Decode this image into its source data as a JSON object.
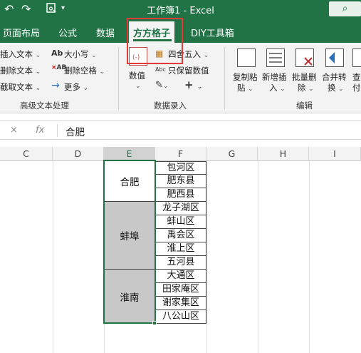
{
  "titlebar": {
    "title": "工作簿1  -  Excel",
    "undo_icon": "undo-icon",
    "redo_icon": "redo-icon",
    "search_icon": "search-icon"
  },
  "tabs": [
    {
      "label": "页面布局",
      "active": false
    },
    {
      "label": "公式",
      "active": false
    },
    {
      "label": "数据",
      "active": false
    },
    {
      "label": "方方格子",
      "active": true
    },
    {
      "label": "DIY工具箱",
      "active": false
    }
  ],
  "ribbon": {
    "group1": {
      "items_left": [
        "插入文本",
        "删除文本",
        "截取文本"
      ],
      "items_right": [
        "大小写",
        "删除空格",
        "更多"
      ],
      "glyphs": [
        "Ab",
        "AB",
        "→"
      ],
      "label": "高级文本处理"
    },
    "group2": {
      "value_button": "数值",
      "items": [
        "四舍五入",
        "只保留数值"
      ],
      "abc_glyph": "Abc",
      "label": "数据录入"
    },
    "group3": {
      "buttons": [
        {
          "line1": "复制粘",
          "line2": "贴"
        },
        {
          "line1": "新增插",
          "line2": "入"
        },
        {
          "line1": "批量删",
          "line2": "除"
        },
        {
          "line1": "合并转",
          "line2": "换"
        },
        {
          "line1": "查",
          "line2": "付"
        }
      ],
      "label": "编辑"
    }
  },
  "formula_bar": {
    "cancel": "×",
    "fx": "fx",
    "value": "合肥"
  },
  "columns": [
    "C",
    "D",
    "E",
    "F",
    "G",
    "H",
    "I"
  ],
  "selected_column": "E",
  "merged_cells": [
    {
      "label": "合肥",
      "rows": 3,
      "shaded": false
    },
    {
      "label": "蚌埠",
      "rows": 5,
      "shaded": true
    },
    {
      "label": "淮南",
      "rows": 4,
      "shaded": true
    }
  ],
  "districts": [
    "包河区",
    "肥东县",
    "肥西县",
    "龙子湖区",
    "蚌山区",
    "禹会区",
    "淮上区",
    "五河县",
    "大通区",
    "田家庵区",
    "谢家集区",
    "八公山区"
  ],
  "colors": {
    "excel_green": "#217346",
    "highlight_red": "#e03a3a",
    "shaded_cell": "#c8c8c8"
  }
}
